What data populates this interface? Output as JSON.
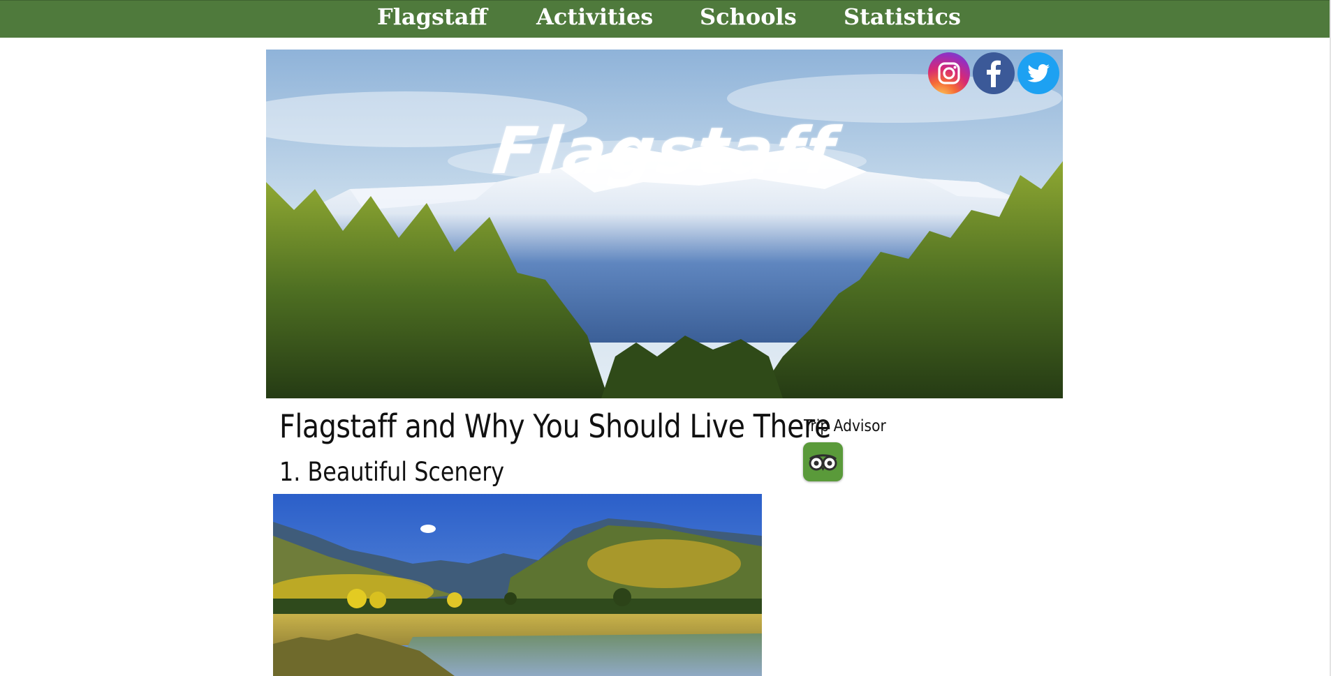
{
  "nav": {
    "items": [
      {
        "label": "Flagstaff"
      },
      {
        "label": "Activities"
      },
      {
        "label": "Schools"
      },
      {
        "label": "Statistics"
      }
    ]
  },
  "hero": {
    "title": "Flagstaff",
    "social": [
      {
        "name": "instagram",
        "icon": "instagram-icon"
      },
      {
        "name": "facebook",
        "icon": "facebook-icon"
      },
      {
        "name": "twitter",
        "icon": "twitter-icon"
      }
    ]
  },
  "main": {
    "title": "Flagstaff and Why You Should Live There",
    "section_heading": "1. Beautiful Scenery"
  },
  "sidebar": {
    "title": "Trip Advisor",
    "icon": "tripadvisor-owl-icon"
  },
  "colors": {
    "nav_bg": "#4f7a3c",
    "text": "#111111"
  }
}
